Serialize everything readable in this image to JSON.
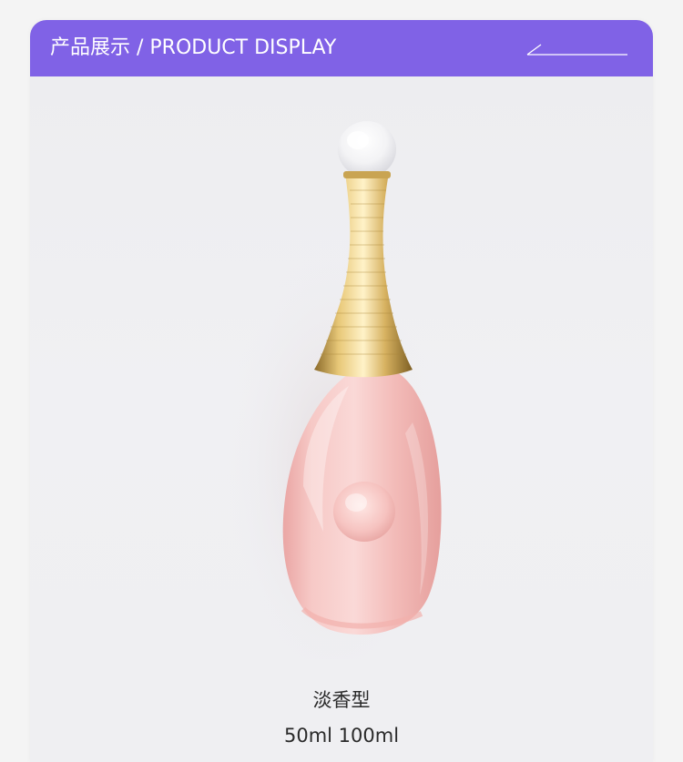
{
  "header": {
    "title": "产品展示 / PRODUCT DISPLAY",
    "accent_color": "#8062e6",
    "decoration_icon": "slash-line-decoration"
  },
  "product": {
    "image_icon": "perfume-bottle-image",
    "scent_type": "淡香型",
    "sizes": "50ml 100ml"
  }
}
